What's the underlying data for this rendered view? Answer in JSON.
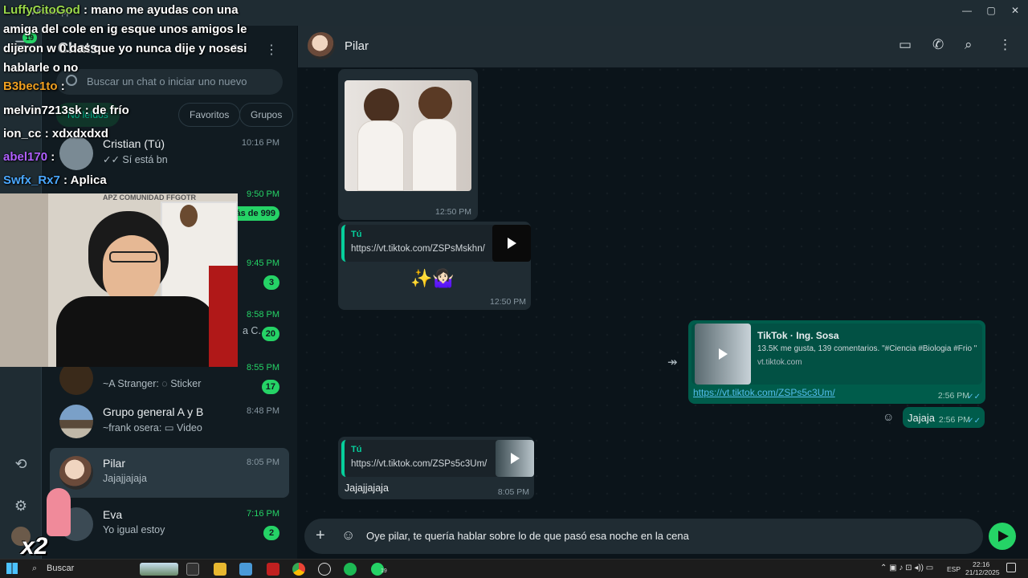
{
  "window": {
    "title": "WhatsApp",
    "min": "—",
    "max": "▢",
    "close": "✕"
  },
  "rail": {
    "badge": "19"
  },
  "sidebar": {
    "title": "Chats",
    "search_placeholder": "Buscar un chat o iniciar uno nuevo",
    "filters": [
      "No leídos",
      "Favoritos",
      "Grupos"
    ],
    "chats": [
      {
        "name": "Cristian (Tú)",
        "preview": "✓✓ Sí está bn",
        "time": "10:16 PM",
        "badge": "",
        "time_green": false
      },
      {
        "name": "",
        "preview": "",
        "time": "9:50 PM",
        "badge": "Más de 999",
        "time_green": true
      },
      {
        "name": "",
        "preview": "",
        "time": "9:45 PM",
        "badge": "3",
        "time_green": true
      },
      {
        "name": "",
        "preview": "a C...",
        "time": "8:58 PM",
        "badge": "20",
        "time_green": true
      },
      {
        "name": "",
        "preview": "~A Stranger: ◌ Sticker",
        "time": "8:55 PM",
        "badge": "17",
        "time_green": true
      },
      {
        "name": "Grupo general A y B",
        "preview": "~frank osera: ▭ Video",
        "time": "8:48 PM",
        "badge": "",
        "time_green": false
      },
      {
        "name": "Pilar",
        "preview": "Jajajjajaja",
        "time": "8:05 PM",
        "badge": "",
        "time_green": false
      },
      {
        "name": "Eva",
        "preview": "Yo igual estoy",
        "time": "7:16 PM",
        "badge": "2",
        "time_green": true
      }
    ],
    "partial_label": "APZ COMUNIDAD FFGOTR"
  },
  "chat": {
    "contact": "Pilar",
    "messages": {
      "img_time": "12:50 PM",
      "link1": {
        "who": "Tú",
        "url": "https://vt.tiktok.com/ZSPsMskhn/",
        "emoji": "✨🤷🏻‍♀️",
        "time": "12:50 PM"
      },
      "tiktok": {
        "title": "TikTok · Ing. Sosa",
        "desc": "13.5K me gusta, 139 comentarios. \"#Ciencia #Biologia #Frio \"",
        "domain": "vt.tiktok.com",
        "url": "https://vt.tiktok.com/ZSPs5c3Um/",
        "time": "2:56 PM"
      },
      "jajaja": {
        "text": "Jajaja",
        "time": "2:56 PM"
      },
      "link2": {
        "who": "Tú",
        "url": "https://vt.tiktok.com/ZSPs5c3Um/",
        "text": "Jajajjajaja",
        "time": "8:05 PM"
      }
    },
    "composer_text": "Oye pilar, te quería hablar sobre lo de que pasó esa noche en la cena"
  },
  "stream_chat": [
    {
      "user": "LuffyCitoGod",
      "color": "#9ad84a",
      "text": ": mano me ayudas con una amiga del cole en ig esque unos amigos le dijeron w 0.das que yo nunca dije y nosesi hablarle o no"
    },
    {
      "user": "B3bec1to",
      "color": "#f0a020",
      "text": ":"
    },
    {
      "user": "melvin7213sk",
      "color": "#ffffff",
      "text": ": de frío"
    },
    {
      "user": "ion_cc",
      "color": "#ffffff",
      "text": ": xdxdxdxd"
    },
    {
      "user": "abel170",
      "color": "#b060ff",
      "text": ":"
    },
    {
      "user": "Swfx_Rx7",
      "color": "#4aa8ff",
      "text": ": Aplica"
    }
  ],
  "stream_overlay": {
    "multiplier": "x2"
  },
  "taskbar": {
    "search": "Buscar",
    "lang": "ESP",
    "time": "22:16",
    "date": "21/12/2025",
    "wa_badge": "19"
  },
  "colors": {
    "accent": "#25d366",
    "outgoing": "#005c4b",
    "incoming": "#202c33",
    "panel": "#111b21"
  }
}
